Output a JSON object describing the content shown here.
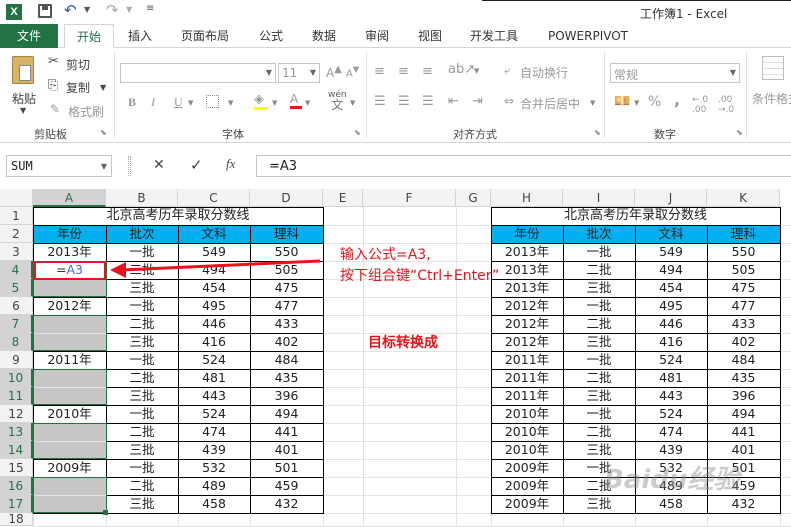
{
  "window": {
    "title": "工作簿1 - Excel"
  },
  "tabs": [
    "文件",
    "开始",
    "插入",
    "页面布局",
    "公式",
    "数据",
    "审阅",
    "视图",
    "开发工具",
    "POWERPIVOT"
  ],
  "ribbon": {
    "paste": "粘贴",
    "cut": "剪切",
    "copy": "复制",
    "format_painter": "格式刷",
    "clipboard_group": "剪贴板",
    "font_size": "11",
    "font_group": "字体",
    "bold": "B",
    "italic": "I",
    "underline": "U",
    "wen": "wén",
    "wrap_text": "自动换行",
    "merge_center": "合并后居中",
    "align_group": "对齐方式",
    "number_format": "常规",
    "percent": "%",
    "comma": ",",
    "number_group": "数字",
    "cond_format": "条件格式"
  },
  "formula_bar": {
    "name_box": "SUM",
    "cancel": "✕",
    "enter": "✓",
    "fx": "fx",
    "formula": "=A3"
  },
  "columns": [
    "A",
    "B",
    "C",
    "D",
    "E",
    "F",
    "G",
    "H",
    "I",
    "J",
    "K"
  ],
  "rows": [
    "1",
    "2",
    "3",
    "4",
    "5",
    "6",
    "7",
    "8",
    "9",
    "10",
    "11",
    "12",
    "13",
    "14",
    "15",
    "16",
    "17",
    "18"
  ],
  "selected_rows": [
    "4",
    "5",
    "7",
    "8",
    "10",
    "11",
    "13",
    "14",
    "16",
    "17"
  ],
  "left_table": {
    "title": "北京高考历年录取分数线",
    "headers": [
      "年份",
      "批次",
      "文科",
      "理科"
    ],
    "rows": [
      [
        "2013年",
        "一批",
        "549",
        "550"
      ],
      [
        "=A3",
        "二批",
        "494",
        "505"
      ],
      [
        "",
        "三批",
        "454",
        "475"
      ],
      [
        "2012年",
        "一批",
        "495",
        "477"
      ],
      [
        "",
        "二批",
        "446",
        "433"
      ],
      [
        "",
        "三批",
        "416",
        "402"
      ],
      [
        "2011年",
        "一批",
        "524",
        "484"
      ],
      [
        "",
        "二批",
        "481",
        "435"
      ],
      [
        "",
        "三批",
        "443",
        "396"
      ],
      [
        "2010年",
        "一批",
        "524",
        "494"
      ],
      [
        "",
        "二批",
        "474",
        "441"
      ],
      [
        "",
        "三批",
        "439",
        "401"
      ],
      [
        "2009年",
        "一批",
        "532",
        "501"
      ],
      [
        "",
        "二批",
        "489",
        "459"
      ],
      [
        "",
        "三批",
        "458",
        "432"
      ]
    ]
  },
  "right_table": {
    "title": "北京高考历年录取分数线",
    "headers": [
      "年份",
      "批次",
      "文科",
      "理科"
    ],
    "rows": [
      [
        "2013年",
        "一批",
        "549",
        "550"
      ],
      [
        "2013年",
        "二批",
        "494",
        "505"
      ],
      [
        "2013年",
        "三批",
        "454",
        "475"
      ],
      [
        "2012年",
        "一批",
        "495",
        "477"
      ],
      [
        "2012年",
        "二批",
        "446",
        "433"
      ],
      [
        "2012年",
        "三批",
        "416",
        "402"
      ],
      [
        "2011年",
        "一批",
        "524",
        "484"
      ],
      [
        "2011年",
        "二批",
        "481",
        "435"
      ],
      [
        "2011年",
        "三批",
        "443",
        "396"
      ],
      [
        "2010年",
        "一批",
        "524",
        "494"
      ],
      [
        "2010年",
        "二批",
        "474",
        "441"
      ],
      [
        "2010年",
        "三批",
        "439",
        "401"
      ],
      [
        "2009年",
        "一批",
        "532",
        "501"
      ],
      [
        "2009年",
        "二批",
        "489",
        "459"
      ],
      [
        "2009年",
        "三批",
        "458",
        "432"
      ]
    ]
  },
  "annotation": {
    "line1": "输入公式=A3,",
    "line2": "按下组合键“Ctrl+Enter”",
    "target": "目标转换成"
  },
  "watermark": "Baidu经验",
  "colors": {
    "excel_green": "#217346",
    "header_fill": "#00b0f0",
    "selection_gray": "#c6c6c6",
    "annotation_red": "#e8141b",
    "active_cell_border": "#e8141b"
  }
}
